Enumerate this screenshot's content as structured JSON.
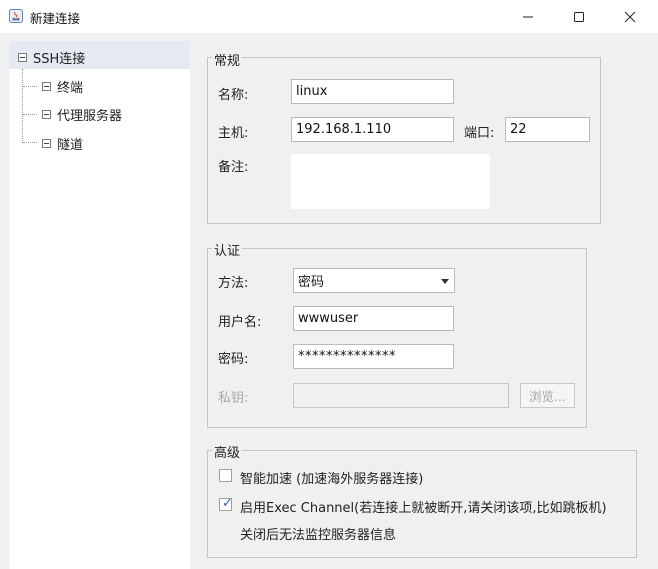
{
  "window": {
    "title": "新建连接",
    "minimize_glyph": "—",
    "maximize_glyph": "☐",
    "close_glyph": "✕"
  },
  "tree": {
    "root": "SSH连接",
    "children": [
      "终端",
      "代理服务器",
      "隧道"
    ]
  },
  "general": {
    "title": "常规",
    "name_label": "名称:",
    "name_value": "linux",
    "host_label": "主机:",
    "host_value": "192.168.1.110",
    "port_label": "端口:",
    "port_value": "22",
    "note_label": "备注:",
    "note_value": ""
  },
  "auth": {
    "title": "认证",
    "method_label": "方法:",
    "method_value": "密码",
    "username_label": "用户名:",
    "username_value": "wwwuser",
    "password_label": "密码:",
    "password_value": "**************",
    "key_label": "私钥:",
    "key_value": "",
    "browse_label": "浏览..."
  },
  "advanced": {
    "title": "高级",
    "smart_accel_label": "智能加速 (加速海外服务器连接)",
    "smart_accel_checked": false,
    "exec_channel_label": "启用Exec Channel(若连接上就被断开,请关闭该项,比如跳板机)",
    "exec_channel_checked": true,
    "exec_channel_note": "关闭后无法监控服务器信息"
  }
}
